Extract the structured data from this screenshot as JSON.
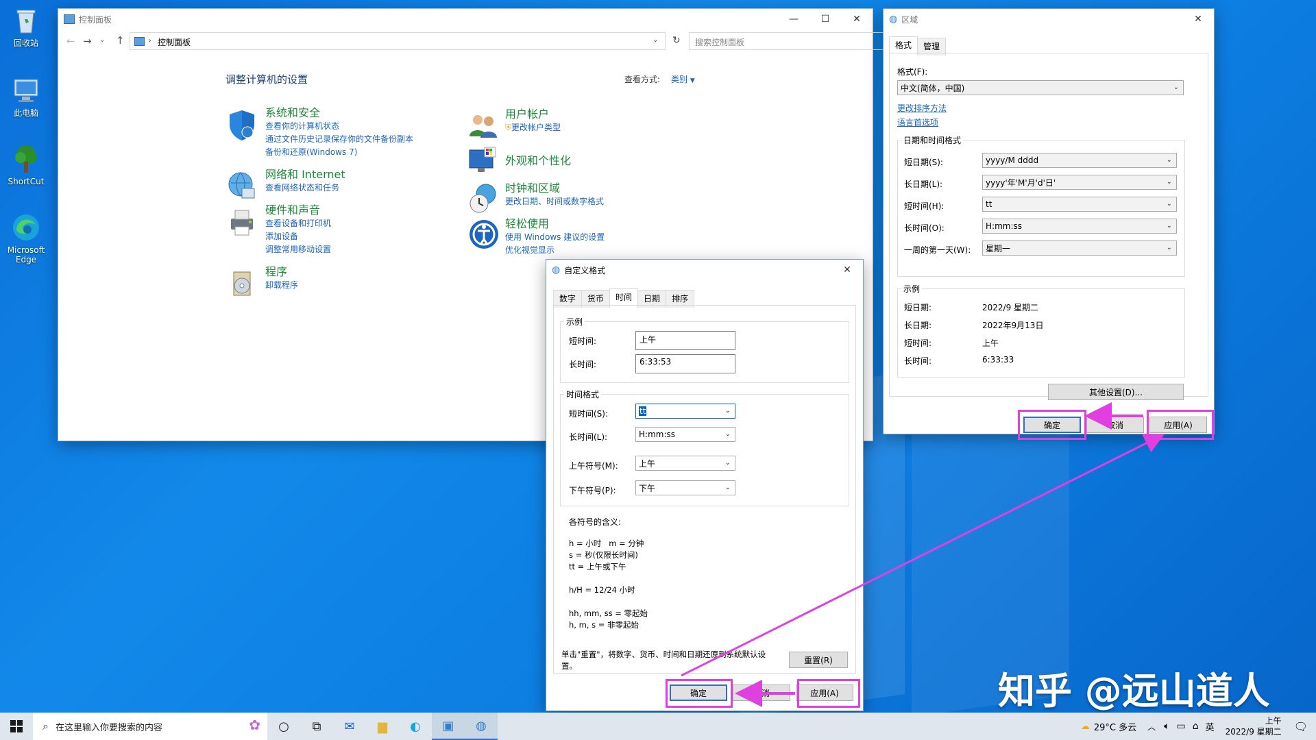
{
  "colors": {
    "accent_link": "#1a63c7",
    "category_green": "#1b8a3a",
    "highlight": "#e040e0",
    "desktop_blue": "#0a78e0"
  },
  "desktop": {
    "icons": [
      {
        "label": "回收站",
        "icon": "recycle-bin-icon"
      },
      {
        "label": "此电脑",
        "icon": "computer-icon"
      },
      {
        "label": "ShortCut",
        "icon": "tree-icon"
      },
      {
        "label": "Microsoft Edge",
        "icon": "edge-icon"
      }
    ],
    "watermark": "知乎 @远山道人"
  },
  "control_panel": {
    "title": "控制面板",
    "address": "控制面板",
    "search_placeholder": "搜索控制面板",
    "heading": "调整计算机的设置",
    "view_by_label": "查看方式:",
    "view_by_value": "类别",
    "categories_left": [
      {
        "title": "系统和安全",
        "links": [
          "查看你的计算机状态",
          "通过文件历史记录保存你的文件备份副本",
          "备份和还原(Windows 7)"
        ]
      },
      {
        "title": "网络和 Internet",
        "links": [
          "查看网络状态和任务"
        ]
      },
      {
        "title": "硬件和声音",
        "links": [
          "查看设备和打印机",
          "添加设备",
          "调整常用移动设置"
        ]
      },
      {
        "title": "程序",
        "links": [
          "卸载程序"
        ]
      }
    ],
    "categories_right": [
      {
        "title": "用户帐户",
        "links": [
          "更改帐户类型"
        ]
      },
      {
        "title": "外观和个性化",
        "links": []
      },
      {
        "title": "时钟和区域",
        "links": [
          "更改日期、时间或数字格式"
        ]
      },
      {
        "title": "轻松使用",
        "links": [
          "使用 Windows 建议的设置",
          "优化视觉显示"
        ]
      }
    ]
  },
  "region": {
    "title": "区域",
    "tabs": [
      "格式",
      "管理"
    ],
    "format_label": "格式(F):",
    "format_value": "中文(简体，中国)",
    "link_sort": "更改排序方法",
    "link_lang": "语言首选项",
    "datetime_group": "日期和时间格式",
    "rows": [
      {
        "label": "短日期(S):",
        "value": "yyyy/M dddd"
      },
      {
        "label": "长日期(L):",
        "value": "yyyy'年'M'月'd'日'"
      },
      {
        "label": "短时间(H):",
        "value": "tt"
      },
      {
        "label": "长时间(O):",
        "value": "H:mm:ss"
      },
      {
        "label": "一周的第一天(W):",
        "value": "星期一"
      }
    ],
    "example_group": "示例",
    "examples": [
      {
        "label": "短日期:",
        "value": "2022/9 星期二"
      },
      {
        "label": "长日期:",
        "value": "2022年9月13日"
      },
      {
        "label": "短时间:",
        "value": "上午"
      },
      {
        "label": "长时间:",
        "value": "6:33:33"
      }
    ],
    "other_settings": "其他设置(D)...",
    "ok": "确定",
    "cancel": "取消",
    "apply": "应用(A)"
  },
  "custom": {
    "title": "自定义格式",
    "tabs": [
      "数字",
      "货币",
      "时间",
      "日期",
      "排序"
    ],
    "example_group": "示例",
    "short_time_label": "短时间:",
    "short_time_value": "上午",
    "long_time_label": "长时间:",
    "long_time_value": "6:33:53",
    "format_group": "时间格式",
    "fmt_rows": [
      {
        "label": "短时间(S):",
        "value": "tt"
      },
      {
        "label": "长时间(L):",
        "value": "H:mm:ss"
      },
      {
        "label": "上午符号(M):",
        "value": "上午"
      },
      {
        "label": "下午符号(P):",
        "value": "下午"
      }
    ],
    "meaning_title": "各符号的含义:",
    "meanings": [
      "h = 小时   m = 分钟",
      "s = 秒(仅限长时间)",
      "tt = 上午或下午",
      "",
      "h/H = 12/24 小时",
      "",
      "hh, mm, ss = 零起始",
      "h, m, s = 非零起始"
    ],
    "reset_note": "单击\"重置\"，将数字、货币、时间和日期还原到系统默认设置。",
    "reset": "重置(R)",
    "ok": "确定",
    "cancel": "取消",
    "apply": "应用(A)"
  },
  "taskbar": {
    "search_placeholder": "在这里输入你要搜索的内容",
    "weather": "29°C 多云",
    "ime": "英",
    "time": "上午",
    "date": "2022/9 星期二"
  }
}
